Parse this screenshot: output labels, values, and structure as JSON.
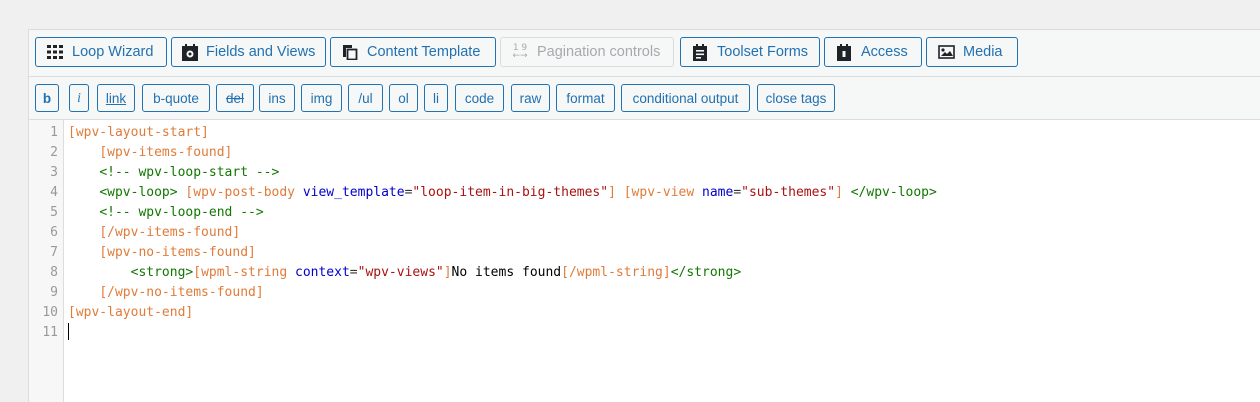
{
  "toolbar": {
    "buttons": [
      {
        "label": "Loop Wizard",
        "icon": "grid-icon"
      },
      {
        "label": "Fields and Views",
        "icon": "toolset-icon"
      },
      {
        "label": "Content Template",
        "icon": "copy-icon"
      },
      {
        "label": "Pagination controls",
        "icon": "pagination-icon",
        "disabled": true
      },
      {
        "label": "Toolset Forms",
        "icon": "forms-icon"
      },
      {
        "label": "Access",
        "icon": "lock-icon"
      },
      {
        "label": "Media",
        "icon": "image-icon"
      }
    ]
  },
  "quicktags": [
    "b",
    "i",
    "link",
    "b-quote",
    "del",
    "ins",
    "img",
    "/ul",
    "ol",
    "li",
    "code",
    "raw",
    "format",
    "conditional output",
    "close tags"
  ],
  "editor": {
    "line_numbers": [
      "1",
      "2",
      "3",
      "4",
      "5",
      "6",
      "7",
      "8",
      "9",
      "10",
      "11"
    ],
    "lines": [
      {
        "tokens": [
          {
            "c": "sc",
            "t": "[wpv-layout-start]"
          }
        ]
      },
      {
        "tokens": [
          {
            "c": "txt",
            "t": "    "
          },
          {
            "c": "sc",
            "t": "[wpv-items-found]"
          }
        ]
      },
      {
        "tokens": [
          {
            "c": "txt",
            "t": "    "
          },
          {
            "c": "cmt",
            "t": "<!-- wpv-loop-start -->"
          }
        ]
      },
      {
        "tokens": [
          {
            "c": "txt",
            "t": "    "
          },
          {
            "c": "tag",
            "t": "<wpv-loop>"
          },
          {
            "c": "txt",
            "t": " "
          },
          {
            "c": "sc",
            "t": "[wpv-post-body"
          },
          {
            "c": "txt",
            "t": " "
          },
          {
            "c": "attr",
            "t": "view_template"
          },
          {
            "c": "eq",
            "t": "="
          },
          {
            "c": "str",
            "t": "\"loop-item-in-big-themes\""
          },
          {
            "c": "sc",
            "t": "]"
          },
          {
            "c": "txt",
            "t": " "
          },
          {
            "c": "sc",
            "t": "[wpv-view"
          },
          {
            "c": "txt",
            "t": " "
          },
          {
            "c": "attr",
            "t": "name"
          },
          {
            "c": "eq",
            "t": "="
          },
          {
            "c": "str",
            "t": "\"sub-themes\""
          },
          {
            "c": "sc",
            "t": "]"
          },
          {
            "c": "txt",
            "t": " "
          },
          {
            "c": "tag",
            "t": "</wpv-loop>"
          }
        ]
      },
      {
        "tokens": [
          {
            "c": "txt",
            "t": "    "
          },
          {
            "c": "cmt",
            "t": "<!-- wpv-loop-end -->"
          }
        ]
      },
      {
        "tokens": [
          {
            "c": "txt",
            "t": "    "
          },
          {
            "c": "sc",
            "t": "[/wpv-items-found]"
          }
        ]
      },
      {
        "tokens": [
          {
            "c": "txt",
            "t": "    "
          },
          {
            "c": "sc",
            "t": "[wpv-no-items-found]"
          }
        ]
      },
      {
        "tokens": [
          {
            "c": "txt",
            "t": "        "
          },
          {
            "c": "tag",
            "t": "<strong>"
          },
          {
            "c": "sc",
            "t": "[wpml-string"
          },
          {
            "c": "txt",
            "t": " "
          },
          {
            "c": "attr",
            "t": "context"
          },
          {
            "c": "eq",
            "t": "="
          },
          {
            "c": "str",
            "t": "\"wpv-views\""
          },
          {
            "c": "sc",
            "t": "]"
          },
          {
            "c": "txt",
            "t": "No items found"
          },
          {
            "c": "sc",
            "t": "[/wpml-string]"
          },
          {
            "c": "tag",
            "t": "</strong>"
          }
        ]
      },
      {
        "tokens": [
          {
            "c": "txt",
            "t": "    "
          },
          {
            "c": "sc",
            "t": "[/wpv-no-items-found]"
          }
        ]
      },
      {
        "tokens": [
          {
            "c": "sc",
            "t": "[wpv-layout-end]"
          }
        ]
      },
      {
        "tokens": []
      }
    ]
  }
}
